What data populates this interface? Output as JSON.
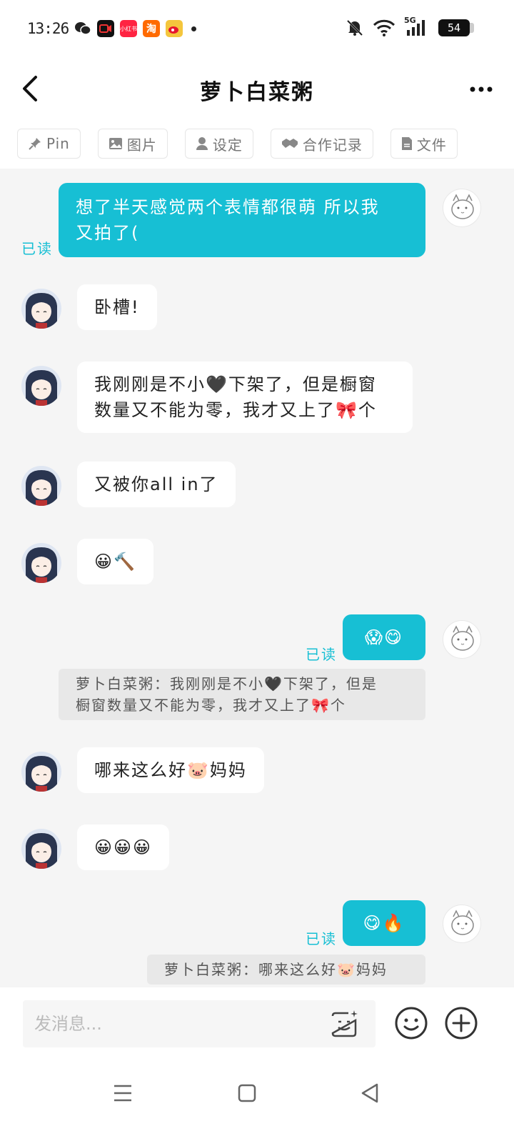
{
  "status_bar": {
    "time": "13:26",
    "battery": "54",
    "network": "5G",
    "apps": [
      {
        "icon": "wechat-icon",
        "label": ""
      },
      {
        "icon": "video-app-icon",
        "label": ""
      },
      {
        "icon": "xiaohongshu-icon",
        "label": "小红书"
      },
      {
        "icon": "taobao-icon",
        "label": "淘"
      },
      {
        "icon": "weibo-icon",
        "label": ""
      }
    ]
  },
  "header": {
    "title": "萝卜白菜粥"
  },
  "tabs": [
    {
      "label": "Pin",
      "icon": "pin-icon"
    },
    {
      "label": "图片",
      "icon": "image-icon"
    },
    {
      "label": "设定",
      "icon": "person-icon"
    },
    {
      "label": "合作记录",
      "icon": "handshake-icon"
    },
    {
      "label": "文件",
      "icon": "file-icon"
    }
  ],
  "messages": [
    {
      "dir": "out",
      "text_line1": "想了半天感觉两个表情都很萌 所以我",
      "text_line2": "又拍了(",
      "read": "已读"
    },
    {
      "dir": "in",
      "text": "卧槽!"
    },
    {
      "dir": "in",
      "text_line1": "我刚刚是不小🖤下架了，但是橱窗",
      "text_line2": "数量又不能为零，我才又上了🎀个"
    },
    {
      "dir": "in",
      "text": "又被你all in了"
    },
    {
      "dir": "in",
      "text": "😀🔨"
    },
    {
      "dir": "out",
      "text": "😱😋",
      "read": "已读",
      "quote_line1": "萝卜白菜粥：我刚刚是不小🖤下架了，但是",
      "quote_line2": "橱窗数量又不能为零，我才又上了🎀个"
    },
    {
      "dir": "in",
      "text": "哪来这么好🐷妈妈"
    },
    {
      "dir": "in",
      "text": "😀😀😀"
    },
    {
      "dir": "out",
      "text": "😋🔥",
      "read": "已读",
      "quote": "萝卜白菜粥：哪来这么好🐷妈妈"
    }
  ],
  "input": {
    "placeholder": "发消息..."
  },
  "colors": {
    "accent": "#17bfd4",
    "chat_bg": "#f5f5f5"
  }
}
